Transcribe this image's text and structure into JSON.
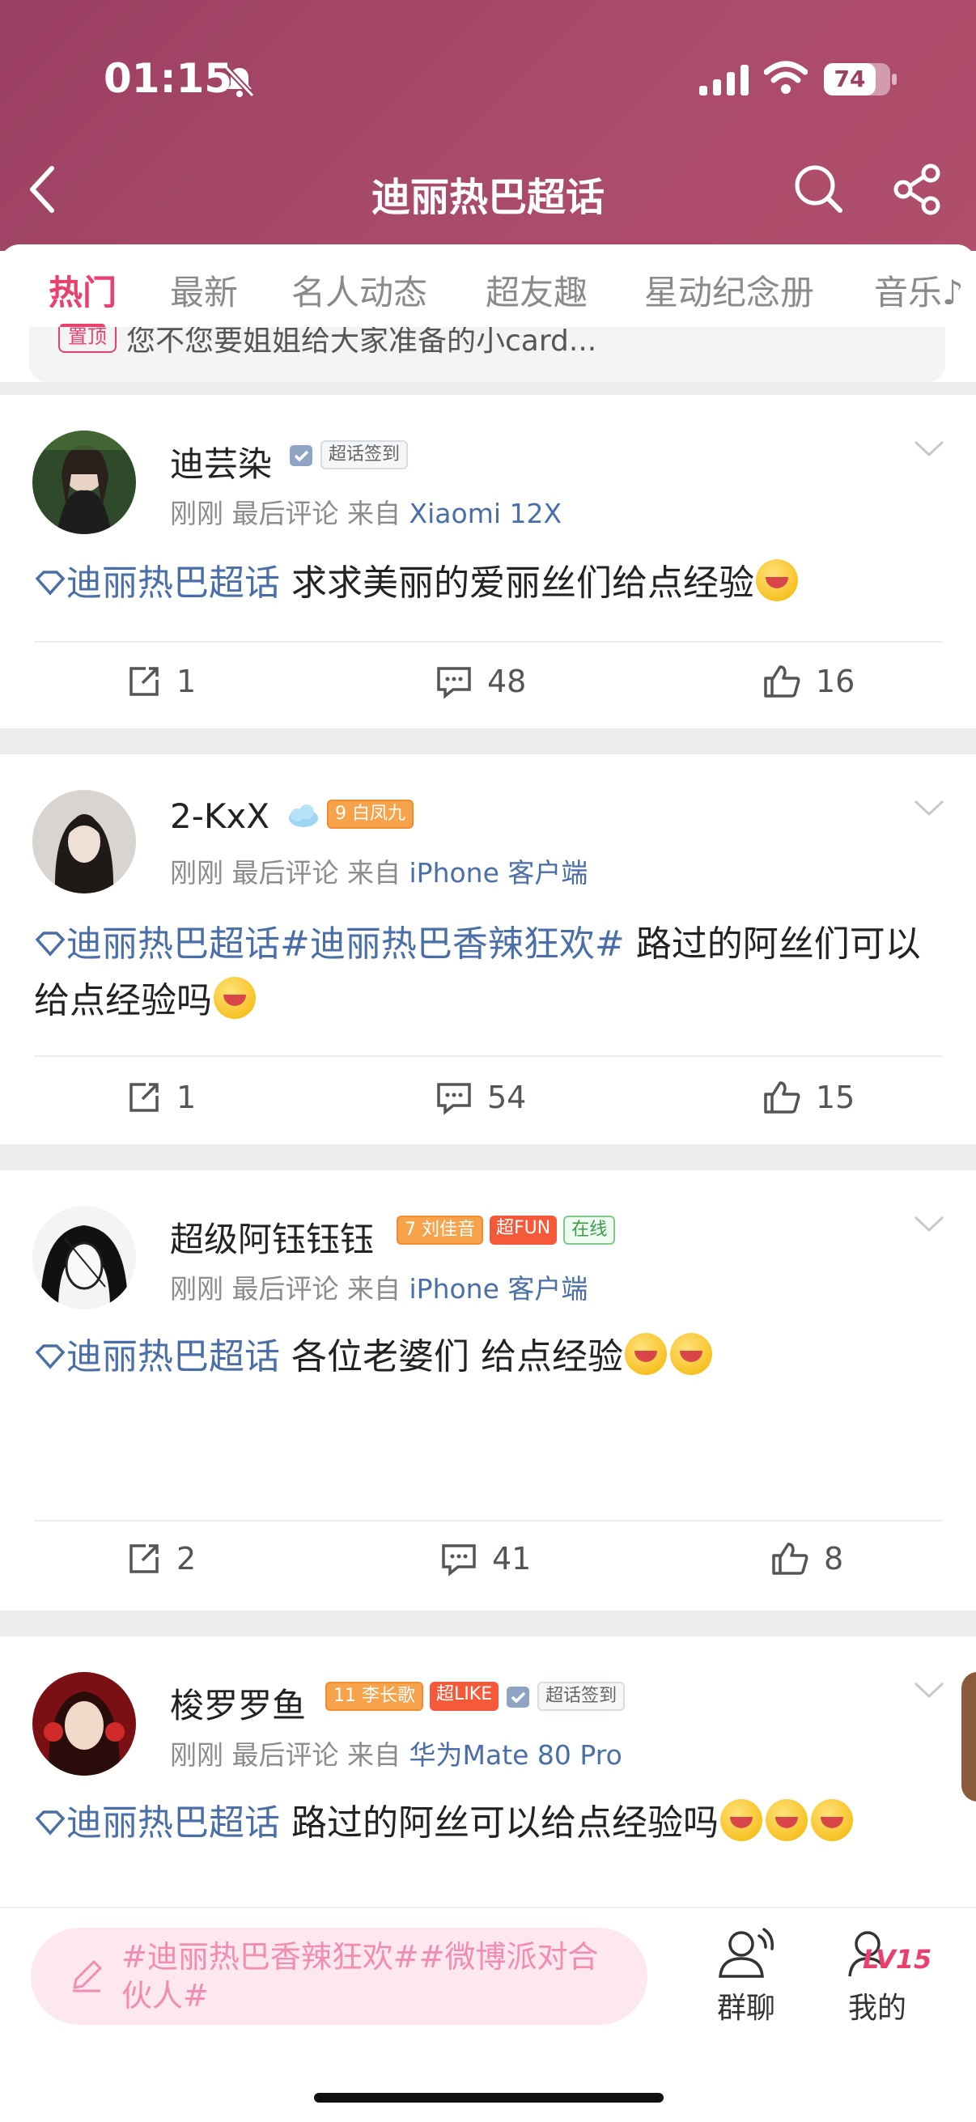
{
  "status": {
    "time": "01:15",
    "battery": "74"
  },
  "header": {
    "title": "迪丽热巴超话"
  },
  "tabs": [
    {
      "label": "热门"
    },
    {
      "label": "最新"
    },
    {
      "label": "名人动态"
    },
    {
      "label": "超友趣"
    },
    {
      "label": "星动纪念册"
    },
    {
      "label": "音乐♪"
    }
  ],
  "pinned": {
    "tag": "置顶",
    "text": "您不您要姐姐给大家准备的小card..."
  },
  "posts": [
    {
      "username": "迪芸染",
      "badges": [
        "超话签到"
      ],
      "time": "刚刚",
      "last_comment": "最后评论",
      "from": "来自",
      "device": "Xiaomi 12X",
      "topic": "迪丽热巴超话",
      "text": " 求求美丽的爱丽丝们给点经验",
      "reposts": "1",
      "comments": "48",
      "likes": "16"
    },
    {
      "username": "2-KxX",
      "badges": [
        "白凤九"
      ],
      "badge_level": "9",
      "time": "刚刚",
      "last_comment": "最后评论",
      "from": "来自",
      "device": "iPhone 客户端",
      "topic": "迪丽热巴超话",
      "topic2": "#迪丽热巴香辣狂欢#",
      "text": " 路过的阿丝们可以给点经验吗",
      "reposts": "1",
      "comments": "54",
      "likes": "15"
    },
    {
      "username": "超级阿钰钰钰",
      "badges": [
        "刘佳音",
        "超FUN",
        "在线"
      ],
      "badge_level": "7",
      "time": "刚刚",
      "last_comment": "最后评论",
      "from": "来自",
      "device": "iPhone 客户端",
      "topic": "迪丽热巴超话",
      "text": "  各位老婆们 给点经验",
      "reposts": "2",
      "comments": "41",
      "likes": "8"
    },
    {
      "username": "梭罗罗鱼",
      "badges": [
        "李长歌",
        "超LIKE",
        "超话签到"
      ],
      "badge_level": "11",
      "time": "刚刚",
      "last_comment": "最后评论",
      "from": "来自",
      "device": "华为Mate 80 Pro",
      "topic": "迪丽热巴超话",
      "text": " 路过的阿丝可以给点经验吗"
    }
  ],
  "bottom": {
    "compose_text": "#迪丽热巴香辣狂欢##微博派对合伙人#",
    "group_chat": "群聊",
    "mine": "我的",
    "level": "LV15"
  }
}
